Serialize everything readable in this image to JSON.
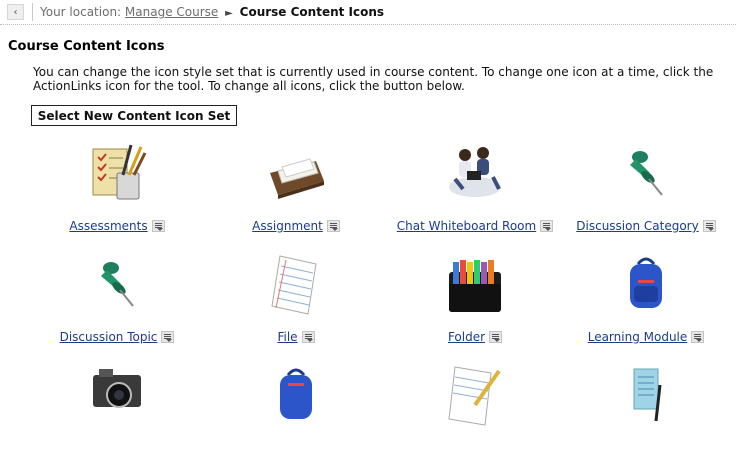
{
  "breadcrumb": {
    "back_symbol": "‹",
    "label": "Your location:",
    "parent": "Manage Course",
    "current": "Course Content Icons"
  },
  "page": {
    "title": "Course Content Icons",
    "description_line1": "You can change the icon style set that is currently used in course content. To change one icon at a time, click the",
    "description_line2": "ActionLinks icon for the tool. To change all icons, click the button below.",
    "button_label": "Select New Content Icon Set"
  },
  "icons": [
    {
      "label": "Assessments",
      "icon": "assessment-icon"
    },
    {
      "label": "Assignment",
      "icon": "assignment-tray-icon"
    },
    {
      "label": "Chat Whiteboard Room",
      "icon": "chat-people-icon"
    },
    {
      "label": "Discussion Category",
      "icon": "pushpin-icon"
    },
    {
      "label": "Discussion Topic",
      "icon": "pushpin-icon"
    },
    {
      "label": "File",
      "icon": "file-paper-icon"
    },
    {
      "label": "Folder",
      "icon": "folder-sorter-icon"
    },
    {
      "label": "Learning Module",
      "icon": "backpack-icon"
    },
    {
      "label": "",
      "icon": "camera-icon"
    },
    {
      "label": "",
      "icon": "backpack-icon"
    },
    {
      "label": "",
      "icon": "paper-pencil-icon"
    },
    {
      "label": "",
      "icon": "notepad-pen-icon"
    }
  ]
}
